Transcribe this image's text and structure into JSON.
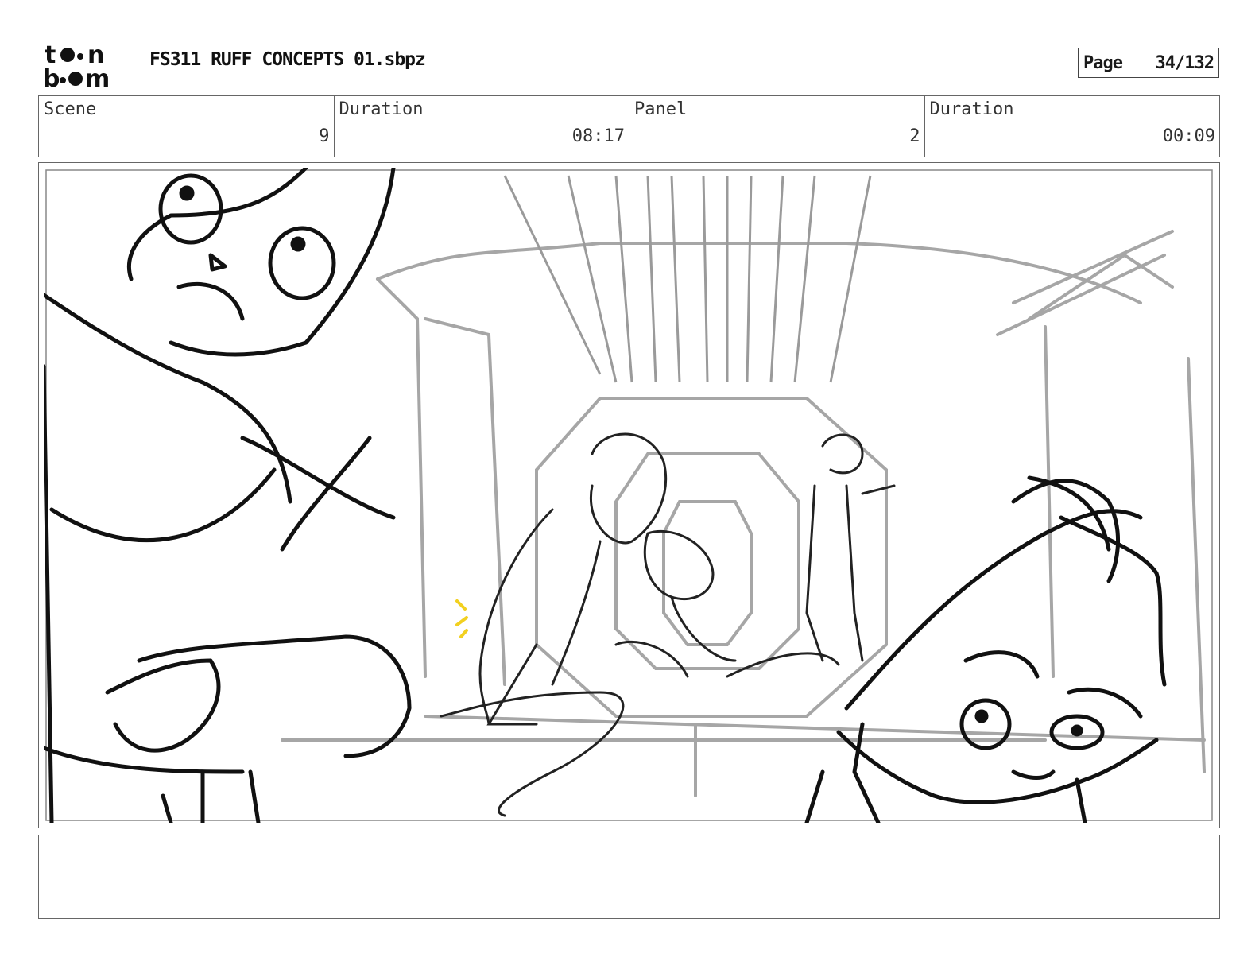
{
  "header": {
    "logo_text": "toon boom",
    "document_title": "FS311 RUFF CONCEPTS 01.sbpz",
    "page_label": "Page",
    "page_number": "34/132"
  },
  "info": {
    "scene_label": "Scene",
    "scene_value": "9",
    "scene_duration_label": "Duration",
    "scene_duration_value": "08:17",
    "panel_label": "Panel",
    "panel_value": "2",
    "panel_duration_label": "Duration",
    "panel_duration_value": "00:09"
  },
  "panel": {
    "image_icon": "storyboard-sketch"
  },
  "notes": {
    "text": ""
  },
  "colors": {
    "border": "#666666",
    "sketch_ink": "#111111",
    "background_sketch": "#a0a0a0",
    "accent_marks": "#f2d020"
  }
}
